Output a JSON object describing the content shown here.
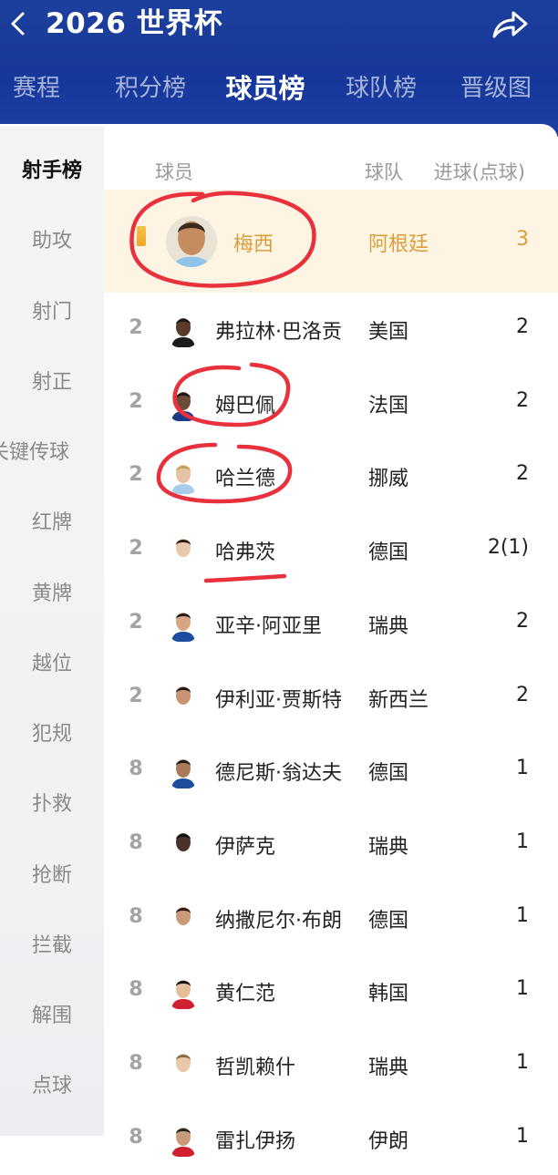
{
  "header": {
    "title": "2026 世界杯"
  },
  "tabs": [
    "赛程",
    "积分榜",
    "球员榜",
    "球队榜",
    "晋级图"
  ],
  "active_tab": "球员榜",
  "sidebar": [
    "射手榜",
    "助攻",
    "射门",
    "射正",
    "关键传球",
    "红牌",
    "黄牌",
    "越位",
    "犯规",
    "扑救",
    "抢断",
    "拦截",
    "解围",
    "点球"
  ],
  "active_sidebar": "射手榜",
  "columns": {
    "player": "球员",
    "team": "球队",
    "goals": "进球(点球)"
  },
  "players": [
    {
      "rank": "",
      "name": "梅西",
      "team": "阿根廷",
      "goals": "3"
    },
    {
      "rank": "2",
      "name": "弗拉林·巴洛贡",
      "team": "美国",
      "goals": "2"
    },
    {
      "rank": "2",
      "name": "姆巴佩",
      "team": "法国",
      "goals": "2"
    },
    {
      "rank": "2",
      "name": "哈兰德",
      "team": "挪威",
      "goals": "2"
    },
    {
      "rank": "2",
      "name": "哈弗茨",
      "team": "德国",
      "goals": "2(1)"
    },
    {
      "rank": "2",
      "name": "亚辛·阿亚里",
      "team": "瑞典",
      "goals": "2"
    },
    {
      "rank": "2",
      "name": "伊利亚·贾斯特",
      "team": "新西兰",
      "goals": "2"
    },
    {
      "rank": "8",
      "name": "德尼斯·翁达夫",
      "team": "德国",
      "goals": "1"
    },
    {
      "rank": "8",
      "name": "伊萨克",
      "team": "瑞典",
      "goals": "1"
    },
    {
      "rank": "8",
      "name": "纳撒尼尔·布朗",
      "team": "德国",
      "goals": "1"
    },
    {
      "rank": "8",
      "name": "黄仁范",
      "team": "韩国",
      "goals": "1"
    },
    {
      "rank": "8",
      "name": "哲凯赖什",
      "team": "瑞典",
      "goals": "1"
    },
    {
      "rank": "8",
      "name": "雷扎伊扬",
      "team": "伊朗",
      "goals": "1"
    }
  ],
  "colors": {
    "header_blue": "#1a3a9a",
    "highlight_bg": "#fdf4e4",
    "highlight_text": "#d9a03d",
    "annotation_red": "#e8313c"
  },
  "icons": {
    "back": "chevron-left-icon",
    "share": "share-arrow-icon"
  }
}
